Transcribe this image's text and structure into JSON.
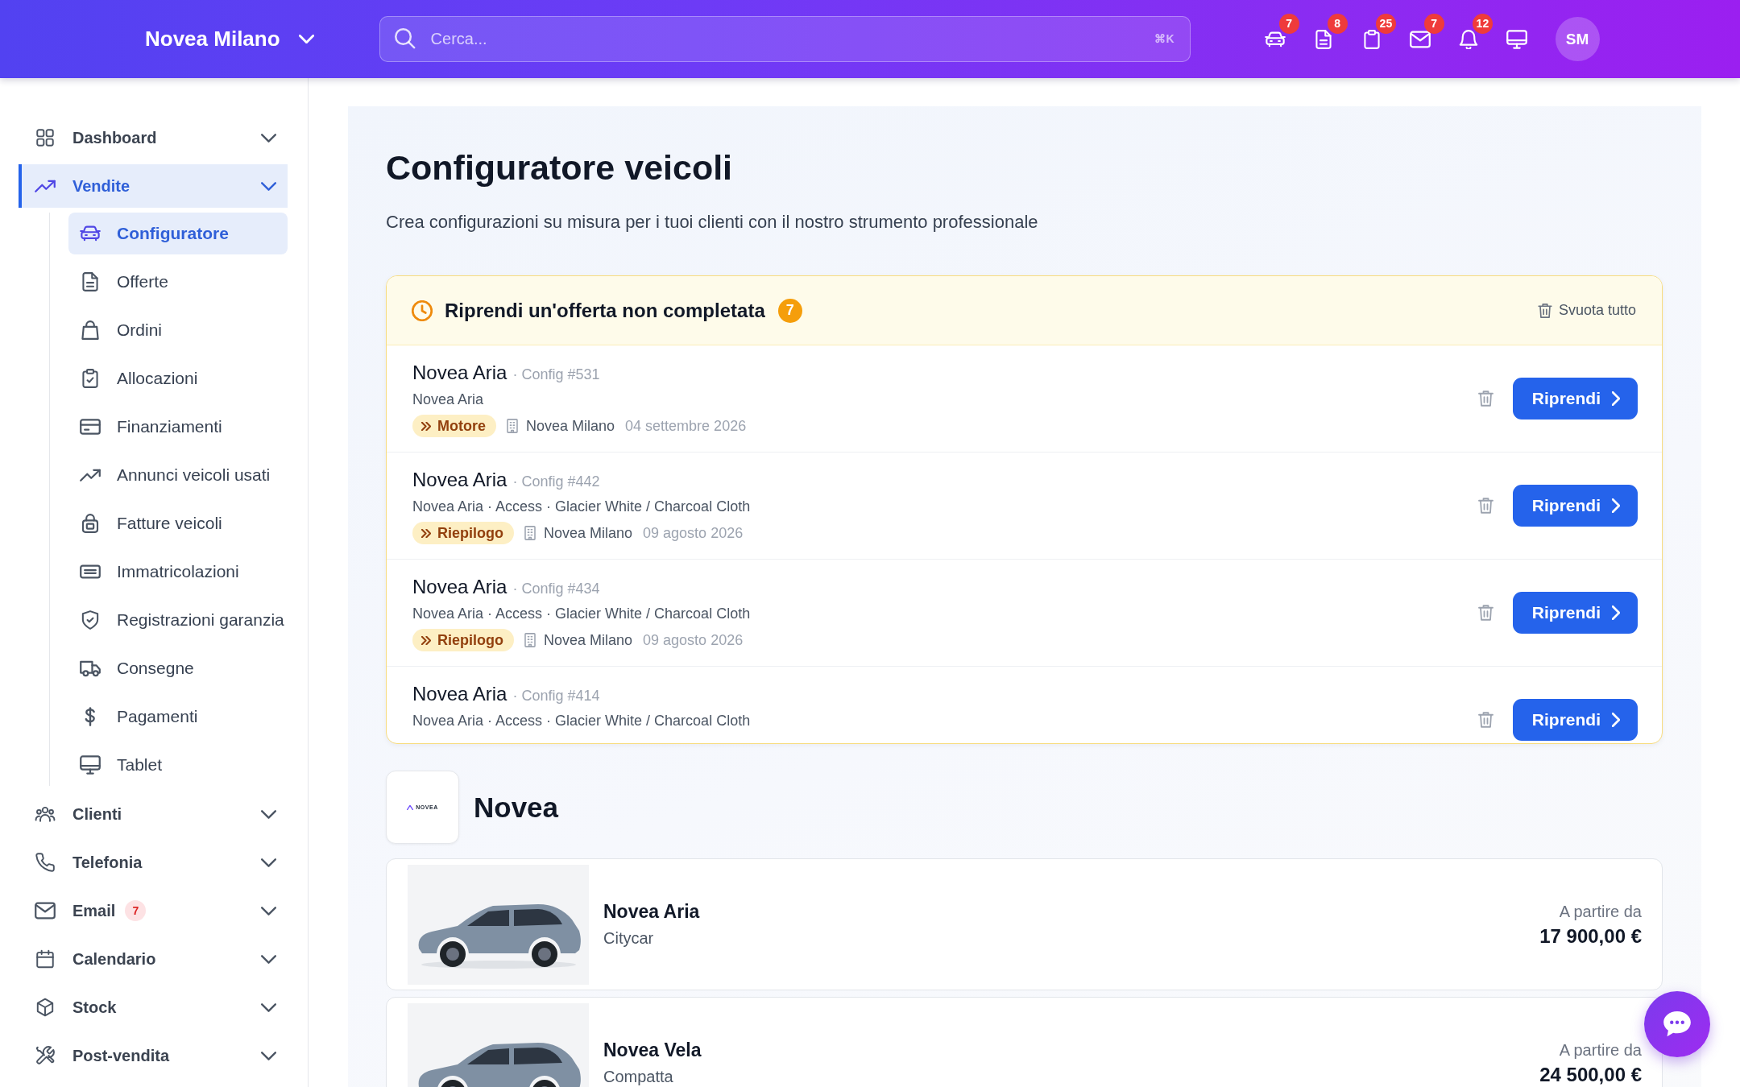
{
  "header": {
    "location": "Novea Milano",
    "search": {
      "placeholder": "Cerca...",
      "shortcut": "⌘K"
    },
    "toolbar": [
      {
        "badge": "7"
      },
      {
        "badge": "8"
      },
      {
        "badge": "25"
      },
      {
        "badge": "7"
      },
      {
        "badge": "12"
      }
    ],
    "avatar": "SM"
  },
  "sidebar": {
    "items": [
      {
        "label": "Dashboard",
        "selected": false
      },
      {
        "label": "Vendite",
        "selected": true,
        "children": [
          {
            "label": "Configuratore",
            "selected": true
          },
          {
            "label": "Offerte",
            "selected": false
          },
          {
            "label": "Ordini",
            "selected": false
          },
          {
            "label": "Allocazioni",
            "selected": false
          },
          {
            "label": "Finanziamenti",
            "selected": false
          },
          {
            "label": "Annunci veicoli usati",
            "selected": false
          },
          {
            "label": "Fatture veicoli",
            "selected": false
          },
          {
            "label": "Immatricolazioni",
            "selected": false
          },
          {
            "label": "Registrazioni garanzia",
            "selected": false
          },
          {
            "label": "Consegne",
            "selected": false
          },
          {
            "label": "Pagamenti",
            "selected": false
          },
          {
            "label": "Tablet",
            "selected": false
          }
        ]
      },
      {
        "label": "Clienti",
        "selected": false
      },
      {
        "label": "Telefonia",
        "selected": false
      },
      {
        "label": "Email",
        "selected": false,
        "badge": "7"
      },
      {
        "label": "Calendario",
        "selected": false
      },
      {
        "label": "Stock",
        "selected": false
      },
      {
        "label": "Post-vendita",
        "selected": false
      }
    ]
  },
  "page": {
    "title": "Configuratore veicoli",
    "subtitle": "Crea configurazioni su misura per i tuoi clienti con il nostro strumento professionale"
  },
  "resume": {
    "title": "Riprendi un'offerta non completata",
    "count": "7",
    "clear_action": "Svuota tutto",
    "offers": [
      {
        "model": "Novea Aria",
        "config": "· Config #531",
        "details": "Novea Aria",
        "step": "Motore",
        "location": "Novea Milano",
        "date": "04 settembre 2026",
        "action": "Riprendi"
      },
      {
        "model": "Novea Aria",
        "config": "· Config #442",
        "details": "Novea Aria · Access · Glacier White / Charcoal Cloth",
        "step": "Riepilogo",
        "location": "Novea Milano",
        "date": "09 agosto 2026",
        "action": "Riprendi"
      },
      {
        "model": "Novea Aria",
        "config": "· Config #434",
        "details": "Novea Aria · Access · Glacier White / Charcoal Cloth",
        "step": "Riepilogo",
        "location": "Novea Milano",
        "date": "09 agosto 2026",
        "action": "Riprendi"
      },
      {
        "model": "Novea Aria",
        "config": "· Config #414",
        "details": "Novea Aria · Access · Glacier White / Charcoal Cloth",
        "action": "Riprendi"
      }
    ]
  },
  "brand": {
    "logo_text": "NOVEA",
    "name": "Novea",
    "vehicles": [
      {
        "name": "Novea Aria",
        "segment": "Citycar",
        "price_label": "A partire da",
        "price": "17 900,00 €"
      },
      {
        "name": "Novea Vela",
        "segment": "Compatta",
        "price_label": "A partire da",
        "price": "24 500,00 €"
      }
    ]
  }
}
